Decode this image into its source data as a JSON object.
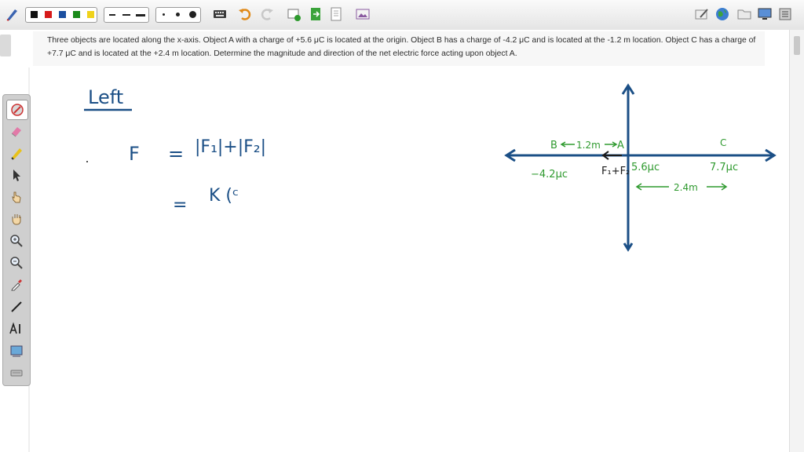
{
  "question": {
    "text": "Three objects are located along the x-axis. Object A with a charge of +5.6 μC is located at the origin. Object B has a charge of -4.2 μC and is located at the -1.2 m location. Object C has a charge of +7.7 μC and is located at the +2.4 m location. Determine the magnitude and direction of the net electric force acting upon object A."
  },
  "toolbar": {
    "colors": [
      "#111111",
      "#d61a1a",
      "#1b4fa0",
      "#1a8a1a",
      "#f0d21a"
    ],
    "accent": "#1b4fa0"
  },
  "whiteboard": {
    "heading": "Left",
    "eq1": {
      "lhs": "F",
      "eq": "=",
      "rhs": "|F₁|+|F₂|"
    },
    "eq2": {
      "eq": "=",
      "rhs": "K (ᶜ"
    },
    "diagram": {
      "label_B": "B",
      "dist_BA": "1.2m",
      "label_A": "A",
      "label_C": "C",
      "charge_B": "−4.2μc",
      "charge_A": "5.6μc",
      "charge_C": "7.7μc",
      "forces": "F₁+F₂",
      "dist_AC": "2.4m"
    },
    "ink_colors": {
      "blue": "#1b4f86",
      "green": "#2f9a2f",
      "black": "#1a1a1a"
    }
  }
}
